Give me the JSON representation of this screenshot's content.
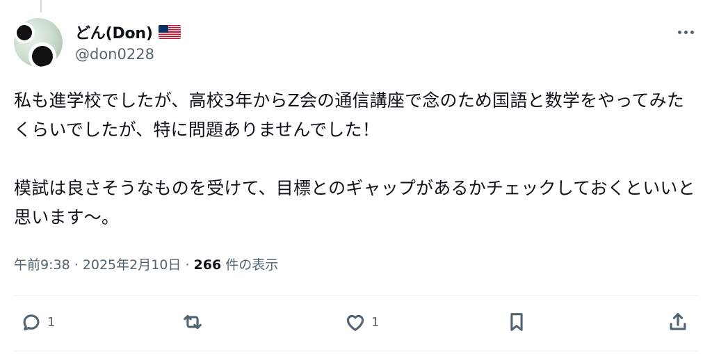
{
  "author": {
    "display_name": "どん(Don)",
    "handle": "@don0228",
    "flag_icon": "us-flag-icon"
  },
  "tweet": {
    "text": "私も進学校でしたが、高校3年からZ会の通信講座で念のため国語と数学をやってみたくらいでしたが、特に問題ありませんでした！\n\n模試は良さそうなものを受けて、目標とのギャップがあるかチェックしておくといいと思います〜。"
  },
  "meta": {
    "time": "午前9:38",
    "separator": " · ",
    "date": "2025年2月10日",
    "views_count": "266",
    "views_label": "件の表示"
  },
  "actions": {
    "reply_count": "1",
    "repost_count": "",
    "like_count": "1"
  },
  "colors": {
    "text": "#0f1419",
    "secondary": "#536471",
    "divider": "#eff3f4"
  }
}
